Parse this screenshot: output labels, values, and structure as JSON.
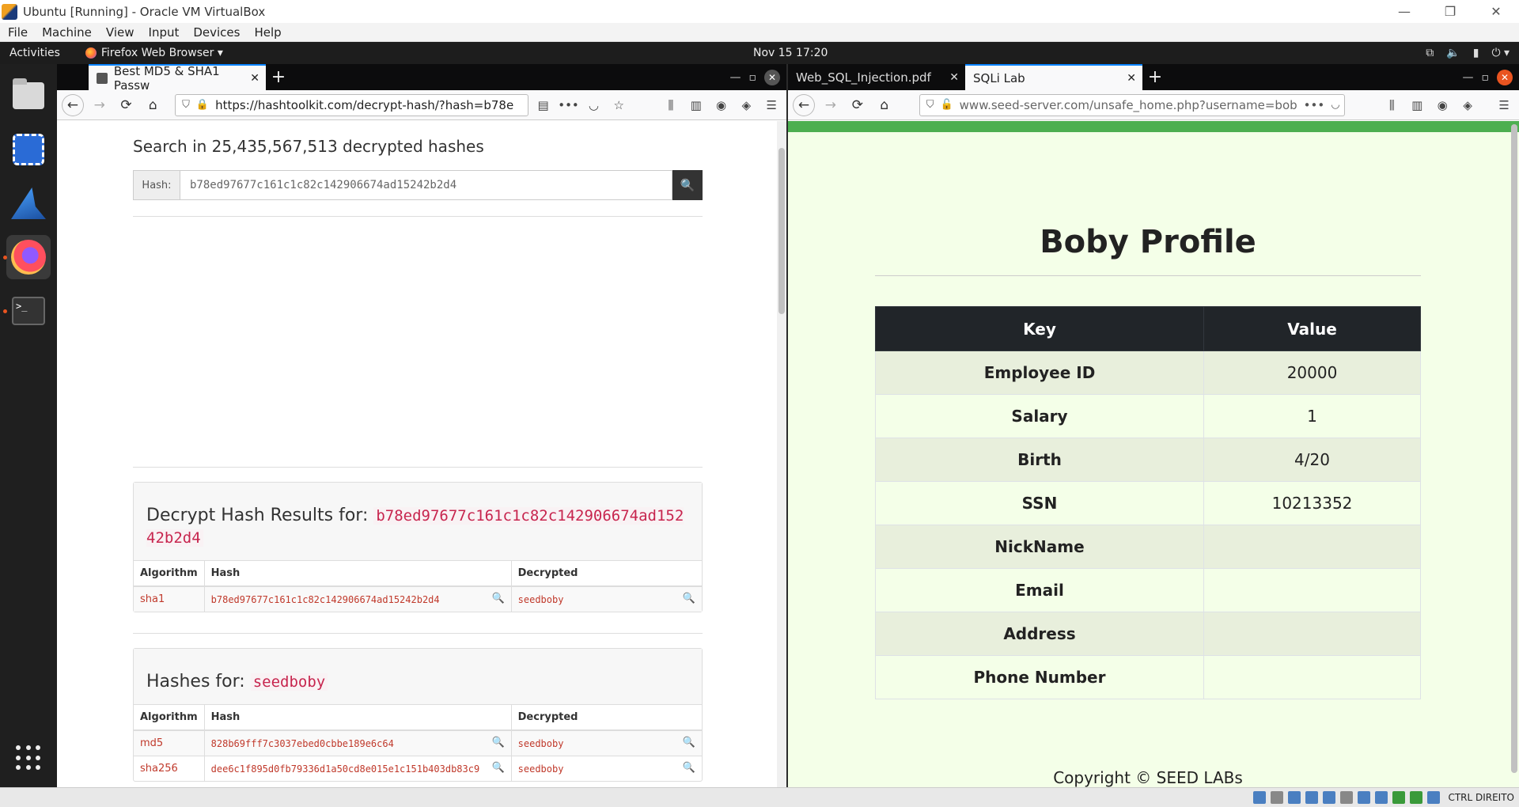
{
  "host": {
    "title": "Ubuntu [Running] - Oracle VM VirtualBox",
    "menu": [
      "File",
      "Machine",
      "View",
      "Input",
      "Devices",
      "Help"
    ],
    "host_key": "CTRL DIREITO"
  },
  "ubuntu": {
    "activities": "Activities",
    "app_name": "Firefox Web Browser ▾",
    "clock": "Nov 15  17:20"
  },
  "left_browser": {
    "tab_title": "Best MD5 & SHA1 Passw",
    "url": "https://hashtoolkit.com/decrypt-hash/?hash=b78e",
    "search_title": "Search in 25,435,567,513 decrypted hashes",
    "hash_label": "Hash:",
    "hash_value": "b78ed97677c161c1c82c142906674ad15242b2d4",
    "results_heading": "Decrypt Hash Results for:",
    "results_hash": "b78ed97677c161c1c82c142906674ad15242b2d4",
    "columns": [
      "Algorithm",
      "Hash",
      "Decrypted"
    ],
    "results": [
      {
        "algorithm": "sha1",
        "hash": "b78ed97677c161c1c82c142906674ad15242b2d4",
        "decrypted": "seedboby"
      }
    ],
    "hashes_heading": "Hashes for:",
    "hashes_word": "seedboby",
    "hashes": [
      {
        "algorithm": "md5",
        "hash": "828b69fff7c3037ebed0cbbe189e6c64",
        "decrypted": "seedboby"
      },
      {
        "algorithm": "sha256",
        "hash": "dee6c1f895d0fb79336d1a50cd8e015e1c151b403db83c9",
        "decrypted": "seedboby"
      }
    ]
  },
  "right_browser": {
    "tab1_title": "Web_SQL_Injection.pdf",
    "tab2_title": "SQLi Lab",
    "url": "www.seed-server.com/unsafe_home.php?username=bob",
    "profile_title": "Boby Profile",
    "table_headers": [
      "Key",
      "Value"
    ],
    "rows": [
      {
        "key": "Employee ID",
        "value": "20000"
      },
      {
        "key": "Salary",
        "value": "1"
      },
      {
        "key": "Birth",
        "value": "4/20"
      },
      {
        "key": "SSN",
        "value": "10213352"
      },
      {
        "key": "NickName",
        "value": ""
      },
      {
        "key": "Email",
        "value": ""
      },
      {
        "key": "Address",
        "value": ""
      },
      {
        "key": "Phone Number",
        "value": ""
      }
    ],
    "footer": "Copyright © SEED LABs"
  }
}
